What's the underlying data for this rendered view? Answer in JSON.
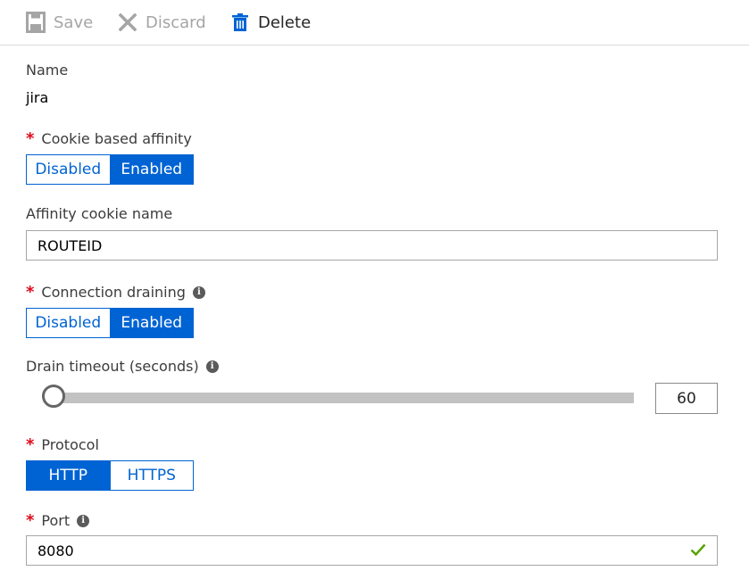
{
  "toolbar": {
    "save_label": "Save",
    "discard_label": "Discard",
    "delete_label": "Delete",
    "disabled_color": "#a5a5a5",
    "accent_color": "#0063d3"
  },
  "form": {
    "name": {
      "label": "Name",
      "value": "jira"
    },
    "cookie_affinity": {
      "label": "Cookie based affinity",
      "required_mark": "*",
      "options": [
        "Disabled",
        "Enabled"
      ],
      "selected": "Enabled"
    },
    "affinity_cookie_name": {
      "label": "Affinity cookie name",
      "value": "ROUTEID"
    },
    "connection_draining": {
      "label": "Connection draining",
      "required_mark": "*",
      "info_icon": "info-icon",
      "options": [
        "Disabled",
        "Enabled"
      ],
      "selected": "Enabled"
    },
    "drain_timeout": {
      "label": "Drain timeout (seconds)",
      "info_icon": "info-icon",
      "value": "60",
      "slider_fraction": 0
    },
    "protocol": {
      "label": "Protocol",
      "required_mark": "*",
      "options": [
        "HTTP",
        "HTTPS"
      ],
      "selected": "HTTP"
    },
    "port": {
      "label": "Port",
      "required_mark": "*",
      "info_icon": "info-icon",
      "value": "8080",
      "valid": true,
      "valid_color": "#57a300"
    }
  }
}
